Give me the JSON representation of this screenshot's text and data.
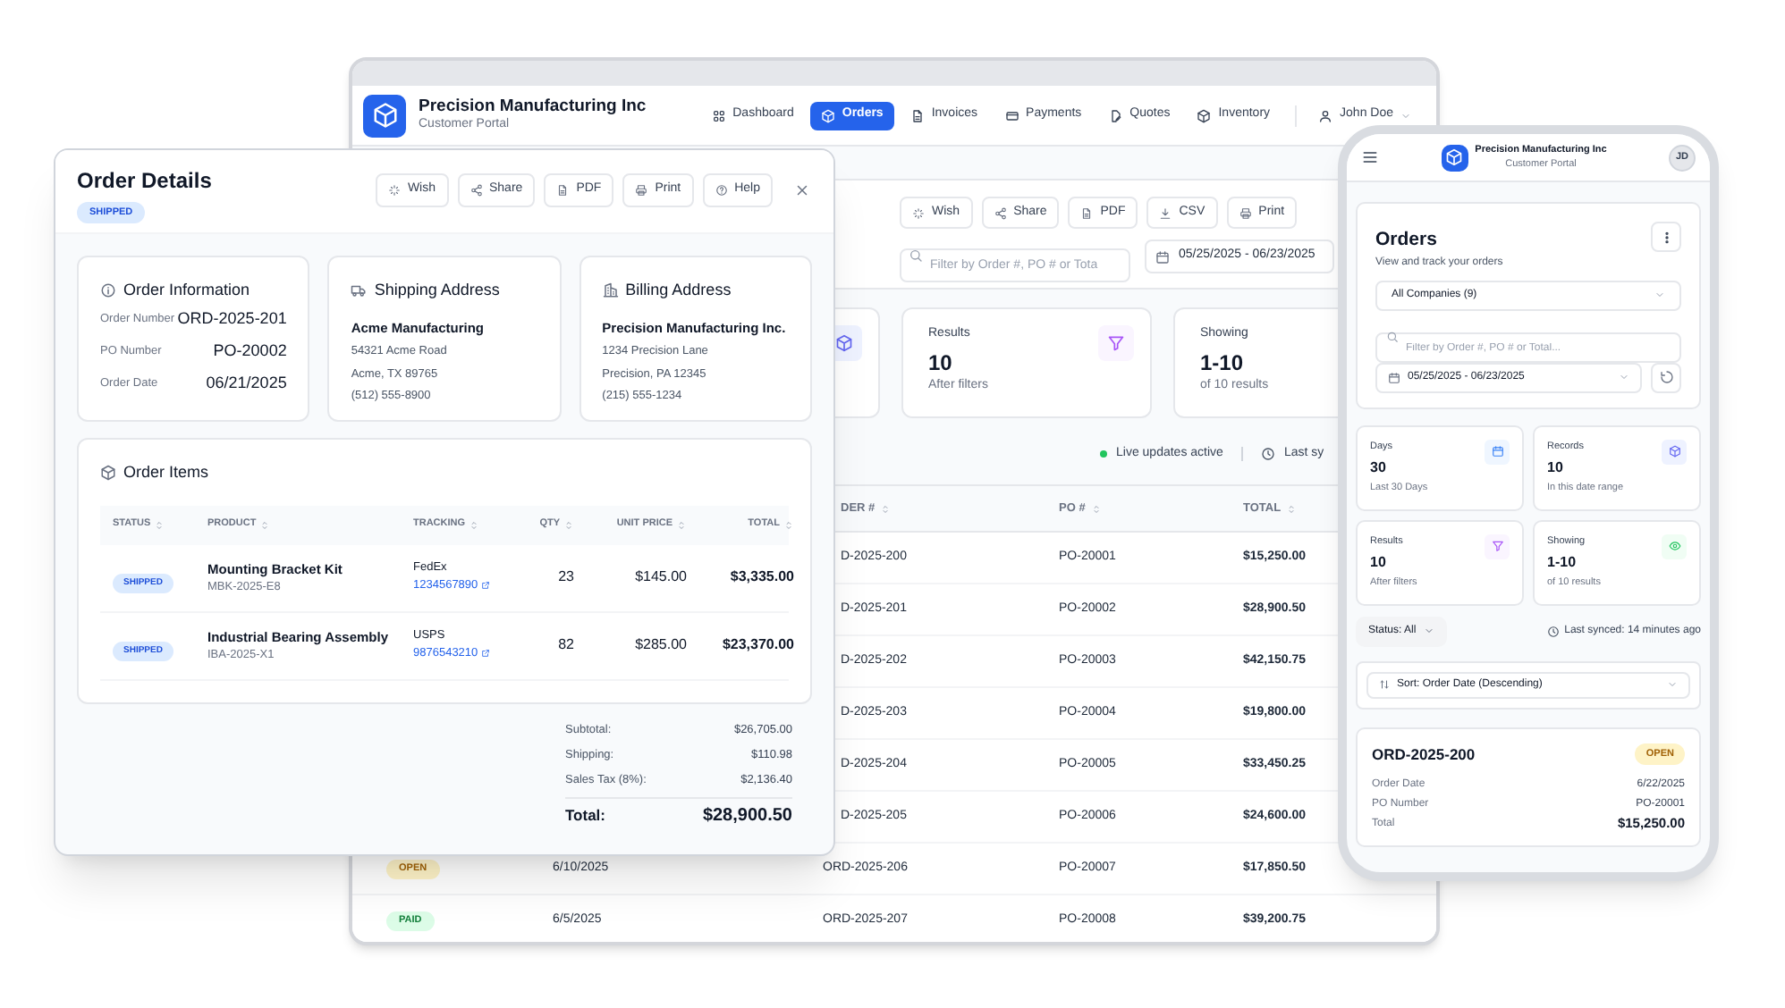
{
  "back_window": {
    "brand": {
      "title": "Precision Manufacturing Inc",
      "subtitle": "Customer Portal"
    },
    "nav": [
      {
        "label": "Dashboard",
        "selected": false
      },
      {
        "label": "Orders",
        "selected": true
      },
      {
        "label": "Invoices",
        "selected": false
      },
      {
        "label": "Payments",
        "selected": false
      },
      {
        "label": "Quotes",
        "selected": false
      },
      {
        "label": "Inventory",
        "selected": false
      }
    ],
    "user": {
      "name": "John Doe"
    },
    "toolbar": [
      "Wish",
      "Share",
      "PDF",
      "CSV",
      "Print"
    ],
    "search": {
      "placeholder": "Filter by Order #, PO # or Tota"
    },
    "date_range": {
      "value": "05/25/2025 - 06/23/2025"
    },
    "stats": [
      {
        "label": "Results",
        "value": "10",
        "note": "After filters"
      },
      {
        "label": "Showing",
        "value": "1-10",
        "note": "of 10 results"
      }
    ],
    "live_status": {
      "text": "Live updates active",
      "synced": "Last sy"
    },
    "table": {
      "columns": [
        "DER #",
        "PO #",
        "TOTAL"
      ],
      "rows": [
        {
          "order": "D-2025-200",
          "po": "PO-20001",
          "total": "$15,250.00"
        },
        {
          "order": "D-2025-201",
          "po": "PO-20002",
          "total": "$28,900.50"
        },
        {
          "order": "D-2025-202",
          "po": "PO-20003",
          "total": "$42,150.75"
        },
        {
          "order": "D-2025-203",
          "po": "PO-20004",
          "total": "$19,800.00"
        },
        {
          "order": "D-2025-204",
          "po": "PO-20005",
          "total": "$33,450.25"
        },
        {
          "order": "D-2025-205",
          "po": "PO-20006",
          "total": "$24,600.00"
        },
        {
          "status": {
            "label": "OPEN",
            "kind": "open"
          },
          "date": "6/10/2025",
          "order": "ORD-2025-206",
          "po": "PO-20007",
          "total": "$17,850.50"
        },
        {
          "status": {
            "label": "PAID",
            "kind": "paid"
          },
          "date": "6/5/2025",
          "order": "ORD-2025-207",
          "po": "PO-20008",
          "total": "$39,200.75"
        }
      ]
    }
  },
  "order_details": {
    "title": "Order Details",
    "status": {
      "label": "SHIPPED",
      "kind": "shipped"
    },
    "actions": [
      "Wish",
      "Share",
      "PDF",
      "Print",
      "Help"
    ],
    "order_information": {
      "title": "Order Information",
      "fields": [
        {
          "label": "Order Number",
          "value": "ORD-2025-201"
        },
        {
          "label": "PO Number",
          "value": "PO-20002"
        },
        {
          "label": "Order Date",
          "value": "06/21/2025"
        }
      ]
    },
    "shipping_address": {
      "title": "Shipping Address",
      "name": "Acme Manufacturing",
      "lines": [
        "54321 Acme Road",
        "Acme, TX 89765",
        "(512) 555-8900"
      ]
    },
    "billing_address": {
      "title": "Billing Address",
      "name": "Precision Manufacturing Inc.",
      "lines": [
        "1234 Precision Lane",
        "Precision, PA 12345",
        "(215) 555-1234"
      ]
    },
    "items": {
      "title": "Order Items",
      "columns": [
        "STATUS",
        "PRODUCT",
        "TRACKING",
        "QTY",
        "UNIT PRICE",
        "TOTAL"
      ],
      "rows": [
        {
          "status": {
            "label": "SHIPPED",
            "kind": "shipped"
          },
          "product": "Mounting Bracket Kit",
          "sku": "MBK-2025-E8",
          "carrier": "FedEx",
          "tracking": "1234567890",
          "qty": "23",
          "unit_price": "$145.00",
          "total": "$3,335.00"
        },
        {
          "status": {
            "label": "SHIPPED",
            "kind": "shipped"
          },
          "product": "Industrial Bearing Assembly",
          "sku": "IBA-2025-X1",
          "carrier": "USPS",
          "tracking": "9876543210",
          "qty": "82",
          "unit_price": "$285.00",
          "total": "$23,370.00"
        }
      ]
    },
    "summary": [
      {
        "label": "Subtotal:",
        "value": "$26,705.00"
      },
      {
        "label": "Shipping:",
        "value": "$110.98"
      },
      {
        "label": "Sales Tax (8%):",
        "value": "$2,136.40"
      }
    ],
    "total": {
      "label": "Total:",
      "value": "$28,900.50"
    }
  },
  "mobile": {
    "brand": {
      "title": "Precision Manufacturing Inc",
      "subtitle": "Customer Portal"
    },
    "avatar": "JD",
    "title": "Orders",
    "subtitle": "View and track your orders",
    "company_select": "All Companies (9)",
    "search": {
      "placeholder": "Filter by Order #, PO # or Total..."
    },
    "date_range": "05/25/2025 - 06/23/2025",
    "stats": [
      {
        "label": "Days",
        "value": "30",
        "note": "Last 30 Days"
      },
      {
        "label": "Records",
        "value": "10",
        "note": "In this date range"
      },
      {
        "label": "Results",
        "value": "10",
        "note": "After filters"
      },
      {
        "label": "Showing",
        "value": "1-10",
        "note": "of 10 results"
      }
    ],
    "status_filter": "Status: All",
    "last_synced": "Last synced: 14 minutes ago",
    "sort": "Sort: Order Date (Descending)",
    "order": {
      "id": "ORD-2025-200",
      "status": {
        "label": "OPEN",
        "kind": "open"
      },
      "fields": [
        {
          "label": "Order Date",
          "value": "6/22/2025"
        },
        {
          "label": "PO Number",
          "value": "PO-20001"
        },
        {
          "label": "Total",
          "value": "$15,250.00"
        }
      ]
    }
  }
}
